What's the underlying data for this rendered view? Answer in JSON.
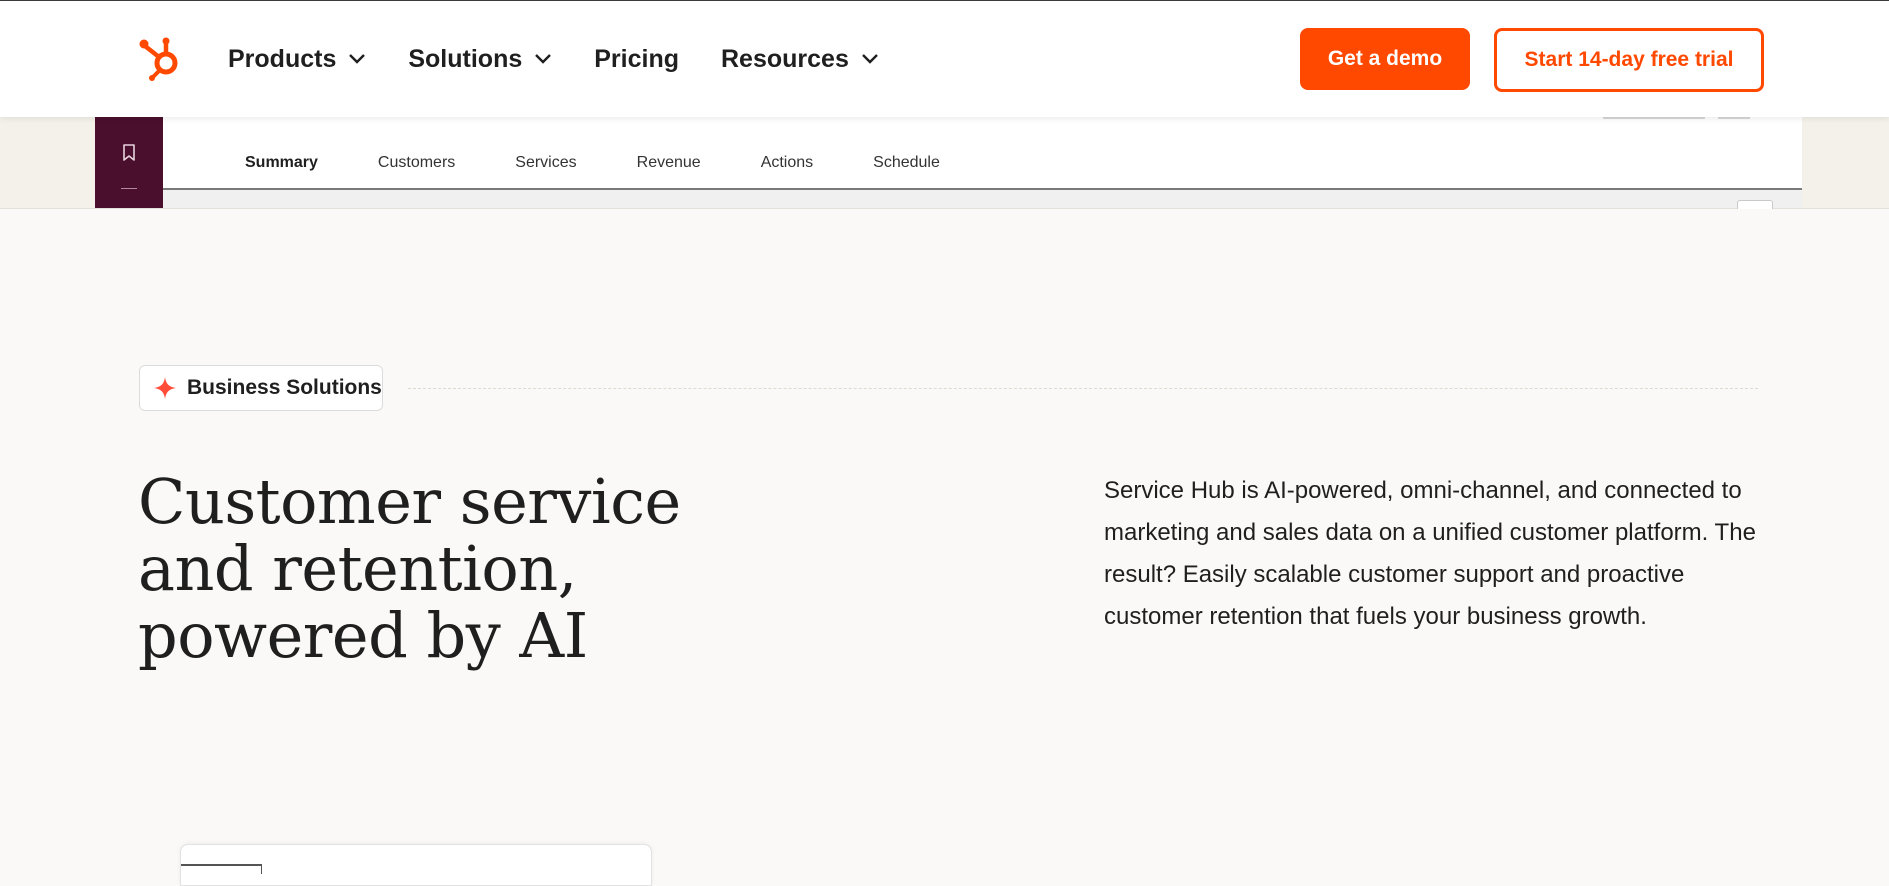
{
  "header": {
    "nav": [
      {
        "label": "Products",
        "has_dropdown": true
      },
      {
        "label": "Solutions",
        "has_dropdown": true
      },
      {
        "label": "Pricing",
        "has_dropdown": false
      },
      {
        "label": "Resources",
        "has_dropdown": true
      }
    ],
    "demo_label": "Get a demo",
    "trial_label": "Start 14-day free trial"
  },
  "preview": {
    "tabs": [
      "Summary",
      "Customers",
      "Services",
      "Revenue",
      "Actions",
      "Schedule"
    ],
    "active_tab": "Summary"
  },
  "hero": {
    "badge": "Business Solutions",
    "title": "Customer service and retention, powered by AI",
    "description": "Service Hub is AI-powered, omni-channel, and connected to marketing and sales data on a unified customer platform. The result? Easily scalable customer support and proactive customer retention that fuels your business growth."
  },
  "colors": {
    "accent": "#ff4800",
    "rail": "#4a0f2c",
    "background": "#faf9f7",
    "text": "#1f1f1f"
  },
  "icons": {
    "logo": "hubspot-sprocket-icon",
    "nav_dropdown": "chevron-down-icon",
    "badge": "sparkle-icon",
    "rail": "bookmark-icon"
  }
}
